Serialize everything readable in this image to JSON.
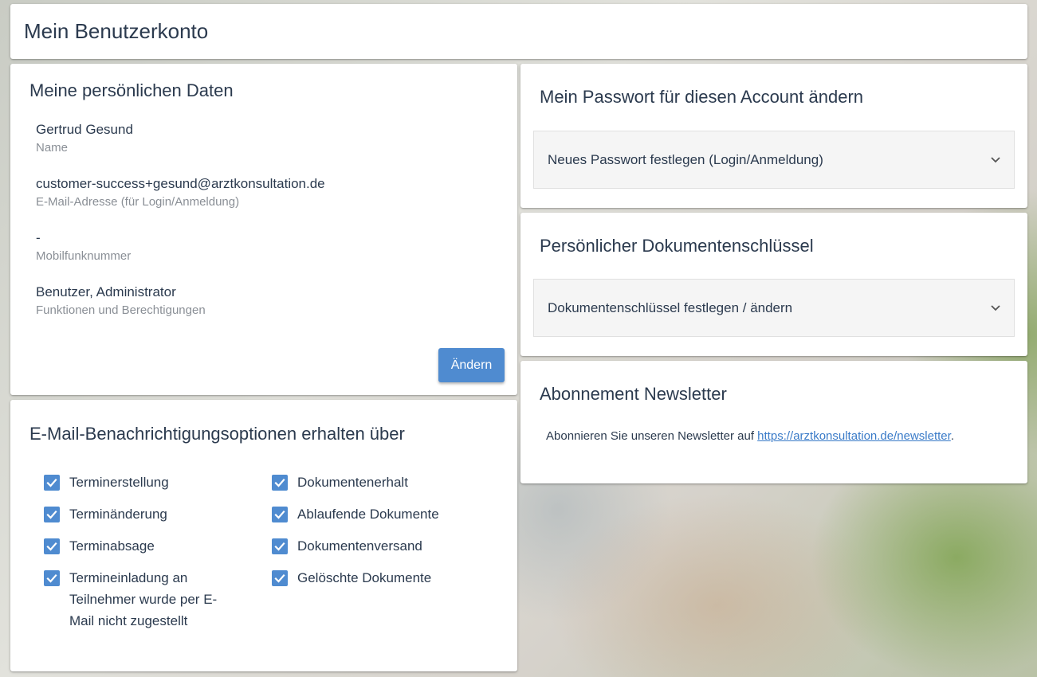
{
  "header": {
    "title": "Mein Benutzerkonto"
  },
  "personal": {
    "title": "Meine persönlichen Daten",
    "fields": [
      {
        "value": "Gertrud Gesund",
        "label": "Name"
      },
      {
        "value": "customer-success+gesund@arztkonsultation.de",
        "label": "E-Mail-Adresse (für Login/Anmeldung)"
      },
      {
        "value": "-",
        "label": "Mobilfunknummer"
      },
      {
        "value": "Benutzer, Administrator",
        "label": "Funktionen und Berechtigungen"
      }
    ],
    "edit_button": "Ändern"
  },
  "notifications": {
    "title": "E-Mail-Benachrichtigungsoptionen erhalten über",
    "left": [
      {
        "label": "Terminerstellung",
        "checked": true
      },
      {
        "label": "Terminänderung",
        "checked": true
      },
      {
        "label": "Terminabsage",
        "checked": true
      },
      {
        "label": "Termineinladung an Teilnehmer wurde per E-Mail nicht zugestellt",
        "checked": true
      }
    ],
    "right": [
      {
        "label": "Dokumentenerhalt",
        "checked": true
      },
      {
        "label": "Ablaufende Dokumente",
        "checked": true
      },
      {
        "label": "Dokumentenversand",
        "checked": true
      },
      {
        "label": "Gelöschte Dokumente",
        "checked": true
      }
    ]
  },
  "password": {
    "title": "Mein Passwort für diesen Account ändern",
    "expander_label": "Neues Passwort festlegen (Login/Anmeldung)"
  },
  "document_key": {
    "title": "Persönlicher Dokumentenschlüssel",
    "expander_label": "Dokumentenschlüssel festlegen / ändern"
  },
  "newsletter": {
    "title": "Abonnement Newsletter",
    "text_before": "Abonnieren Sie unseren Newsletter auf ",
    "link": "https://arztkonsultation.de/newsletter",
    "text_after": "."
  },
  "colors": {
    "accent": "#4f8bd0",
    "link": "#3a7bc8",
    "text": "#2b3a4e",
    "muted": "#8a8f96"
  },
  "icons": {
    "checkbox": "check-icon",
    "expander": "chevron-down-icon"
  }
}
